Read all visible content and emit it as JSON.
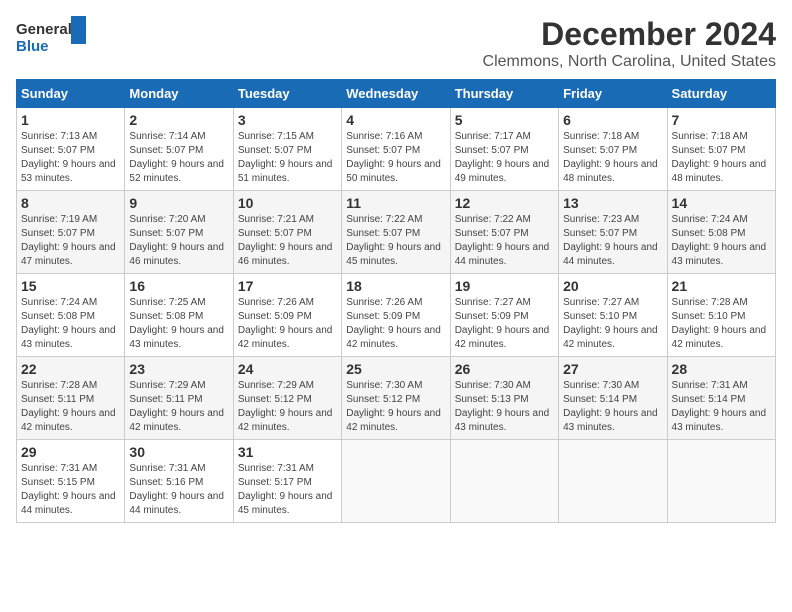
{
  "logo": {
    "line1": "General",
    "line2": "Blue"
  },
  "title": "December 2024",
  "subtitle": "Clemmons, North Carolina, United States",
  "days_of_week": [
    "Sunday",
    "Monday",
    "Tuesday",
    "Wednesday",
    "Thursday",
    "Friday",
    "Saturday"
  ],
  "weeks": [
    [
      {
        "day": "1",
        "sunrise": "7:13 AM",
        "sunset": "5:07 PM",
        "daylight": "9 hours and 53 minutes."
      },
      {
        "day": "2",
        "sunrise": "7:14 AM",
        "sunset": "5:07 PM",
        "daylight": "9 hours and 52 minutes."
      },
      {
        "day": "3",
        "sunrise": "7:15 AM",
        "sunset": "5:07 PM",
        "daylight": "9 hours and 51 minutes."
      },
      {
        "day": "4",
        "sunrise": "7:16 AM",
        "sunset": "5:07 PM",
        "daylight": "9 hours and 50 minutes."
      },
      {
        "day": "5",
        "sunrise": "7:17 AM",
        "sunset": "5:07 PM",
        "daylight": "9 hours and 49 minutes."
      },
      {
        "day": "6",
        "sunrise": "7:18 AM",
        "sunset": "5:07 PM",
        "daylight": "9 hours and 48 minutes."
      },
      {
        "day": "7",
        "sunrise": "7:18 AM",
        "sunset": "5:07 PM",
        "daylight": "9 hours and 48 minutes."
      }
    ],
    [
      {
        "day": "8",
        "sunrise": "7:19 AM",
        "sunset": "5:07 PM",
        "daylight": "9 hours and 47 minutes."
      },
      {
        "day": "9",
        "sunrise": "7:20 AM",
        "sunset": "5:07 PM",
        "daylight": "9 hours and 46 minutes."
      },
      {
        "day": "10",
        "sunrise": "7:21 AM",
        "sunset": "5:07 PM",
        "daylight": "9 hours and 46 minutes."
      },
      {
        "day": "11",
        "sunrise": "7:22 AM",
        "sunset": "5:07 PM",
        "daylight": "9 hours and 45 minutes."
      },
      {
        "day": "12",
        "sunrise": "7:22 AM",
        "sunset": "5:07 PM",
        "daylight": "9 hours and 44 minutes."
      },
      {
        "day": "13",
        "sunrise": "7:23 AM",
        "sunset": "5:07 PM",
        "daylight": "9 hours and 44 minutes."
      },
      {
        "day": "14",
        "sunrise": "7:24 AM",
        "sunset": "5:08 PM",
        "daylight": "9 hours and 43 minutes."
      }
    ],
    [
      {
        "day": "15",
        "sunrise": "7:24 AM",
        "sunset": "5:08 PM",
        "daylight": "9 hours and 43 minutes."
      },
      {
        "day": "16",
        "sunrise": "7:25 AM",
        "sunset": "5:08 PM",
        "daylight": "9 hours and 43 minutes."
      },
      {
        "day": "17",
        "sunrise": "7:26 AM",
        "sunset": "5:09 PM",
        "daylight": "9 hours and 42 minutes."
      },
      {
        "day": "18",
        "sunrise": "7:26 AM",
        "sunset": "5:09 PM",
        "daylight": "9 hours and 42 minutes."
      },
      {
        "day": "19",
        "sunrise": "7:27 AM",
        "sunset": "5:09 PM",
        "daylight": "9 hours and 42 minutes."
      },
      {
        "day": "20",
        "sunrise": "7:27 AM",
        "sunset": "5:10 PM",
        "daylight": "9 hours and 42 minutes."
      },
      {
        "day": "21",
        "sunrise": "7:28 AM",
        "sunset": "5:10 PM",
        "daylight": "9 hours and 42 minutes."
      }
    ],
    [
      {
        "day": "22",
        "sunrise": "7:28 AM",
        "sunset": "5:11 PM",
        "daylight": "9 hours and 42 minutes."
      },
      {
        "day": "23",
        "sunrise": "7:29 AM",
        "sunset": "5:11 PM",
        "daylight": "9 hours and 42 minutes."
      },
      {
        "day": "24",
        "sunrise": "7:29 AM",
        "sunset": "5:12 PM",
        "daylight": "9 hours and 42 minutes."
      },
      {
        "day": "25",
        "sunrise": "7:30 AM",
        "sunset": "5:12 PM",
        "daylight": "9 hours and 42 minutes."
      },
      {
        "day": "26",
        "sunrise": "7:30 AM",
        "sunset": "5:13 PM",
        "daylight": "9 hours and 43 minutes."
      },
      {
        "day": "27",
        "sunrise": "7:30 AM",
        "sunset": "5:14 PM",
        "daylight": "9 hours and 43 minutes."
      },
      {
        "day": "28",
        "sunrise": "7:31 AM",
        "sunset": "5:14 PM",
        "daylight": "9 hours and 43 minutes."
      }
    ],
    [
      {
        "day": "29",
        "sunrise": "7:31 AM",
        "sunset": "5:15 PM",
        "daylight": "9 hours and 44 minutes."
      },
      {
        "day": "30",
        "sunrise": "7:31 AM",
        "sunset": "5:16 PM",
        "daylight": "9 hours and 44 minutes."
      },
      {
        "day": "31",
        "sunrise": "7:31 AM",
        "sunset": "5:17 PM",
        "daylight": "9 hours and 45 minutes."
      },
      null,
      null,
      null,
      null
    ]
  ],
  "labels": {
    "sunrise": "Sunrise:",
    "sunset": "Sunset:",
    "daylight": "Daylight:"
  }
}
